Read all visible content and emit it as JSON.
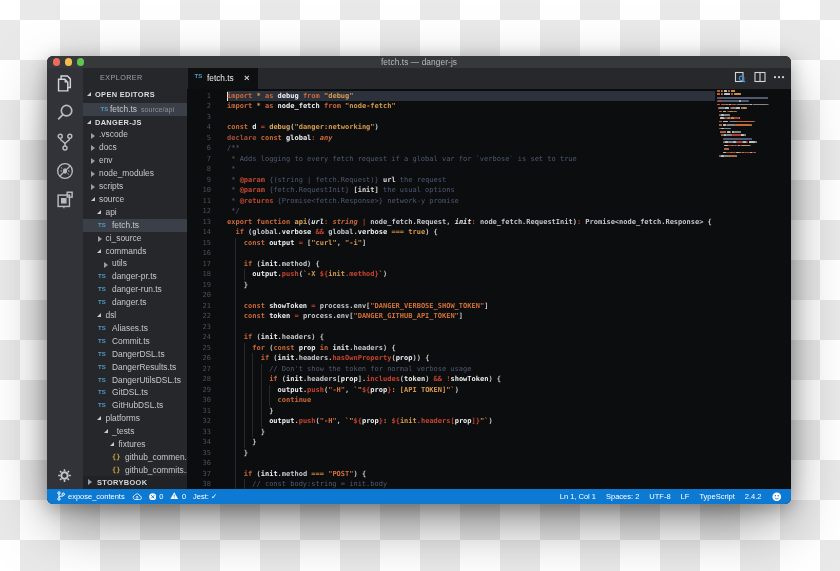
{
  "window": {
    "title": "fetch.ts — danger-js"
  },
  "traffic_lights": [
    {
      "name": "close"
    },
    {
      "name": "minimize"
    },
    {
      "name": "zoom"
    }
  ],
  "activity_bar": {
    "items": [
      {
        "icon": "files-icon",
        "label": "Explorer",
        "active": true
      },
      {
        "icon": "search-icon",
        "label": "Search",
        "active": false
      },
      {
        "icon": "source-control-icon",
        "label": "Source Control",
        "active": false
      },
      {
        "icon": "debug-icon",
        "label": "Debug",
        "active": false
      },
      {
        "icon": "extensions-icon",
        "label": "Extensions",
        "active": false
      }
    ],
    "settings_label": "Settings"
  },
  "sidebar": {
    "title": "EXPLORER",
    "open_editors": {
      "header": "OPEN EDITORS",
      "items": [
        {
          "icon": "TS",
          "label": "fetch.ts",
          "detail": "source/api",
          "selected": true
        }
      ]
    },
    "project": {
      "header": "DANGER-JS",
      "items": [
        {
          "label": ".vscode",
          "depth": 1,
          "kind": "folder-closed"
        },
        {
          "label": "docs",
          "depth": 1,
          "kind": "folder-closed"
        },
        {
          "label": "env",
          "depth": 1,
          "kind": "folder-closed"
        },
        {
          "label": "node_modules",
          "depth": 1,
          "kind": "folder-closed"
        },
        {
          "label": "scripts",
          "depth": 1,
          "kind": "folder-closed"
        },
        {
          "label": "source",
          "depth": 1,
          "kind": "folder-open"
        },
        {
          "label": "api",
          "depth": 2,
          "kind": "folder-open"
        },
        {
          "label": "fetch.ts",
          "depth": 3,
          "kind": "ts",
          "selected": true
        },
        {
          "label": "ci_source",
          "depth": 2,
          "kind": "folder-closed"
        },
        {
          "label": "commands",
          "depth": 2,
          "kind": "folder-open"
        },
        {
          "label": "utils",
          "depth": 3,
          "kind": "folder-closed"
        },
        {
          "label": "danger-pr.ts",
          "depth": 3,
          "kind": "ts"
        },
        {
          "label": "danger-run.ts",
          "depth": 3,
          "kind": "ts"
        },
        {
          "label": "danger.ts",
          "depth": 3,
          "kind": "ts"
        },
        {
          "label": "dsl",
          "depth": 2,
          "kind": "folder-open"
        },
        {
          "label": "Aliases.ts",
          "depth": 3,
          "kind": "ts"
        },
        {
          "label": "Commit.ts",
          "depth": 3,
          "kind": "ts"
        },
        {
          "label": "DangerDSL.ts",
          "depth": 3,
          "kind": "ts"
        },
        {
          "label": "DangerResults.ts",
          "depth": 3,
          "kind": "ts"
        },
        {
          "label": "DangerUtilsDSL.ts",
          "depth": 3,
          "kind": "ts"
        },
        {
          "label": "GitDSL.ts",
          "depth": 3,
          "kind": "ts"
        },
        {
          "label": "GitHubDSL.ts",
          "depth": 3,
          "kind": "ts"
        },
        {
          "label": "platforms",
          "depth": 2,
          "kind": "folder-open"
        },
        {
          "label": "_tests",
          "depth": 3,
          "kind": "folder-open"
        },
        {
          "label": "fixtures",
          "depth": 4,
          "kind": "folder-open"
        },
        {
          "label": "github_commen..",
          "depth": 5,
          "kind": "json"
        },
        {
          "label": "github_commits..",
          "depth": 5,
          "kind": "json"
        }
      ]
    },
    "bottom_section": {
      "header": "STORYBOOK"
    }
  },
  "editor": {
    "tab": {
      "icon": "TS",
      "label": "fetch.ts",
      "close": "×"
    },
    "actions": [
      {
        "icon": "open-preview-icon",
        "label": "Open Preview"
      },
      {
        "icon": "split-editor-icon",
        "label": "Split Editor"
      },
      {
        "icon": "more-actions-icon",
        "label": "More Actions",
        "glyph": "•••"
      }
    ],
    "cursor": {
      "line": 1,
      "col": 1
    }
  },
  "status_bar": {
    "left": [
      {
        "icon": "git-branch-icon",
        "label": "expose_contents"
      },
      {
        "icon": "cloud-upload-icon",
        "label": ""
      },
      {
        "icon": "error-icon",
        "label": "0"
      },
      {
        "icon": "warning-icon",
        "label": "0"
      },
      {
        "icon": "",
        "label": "Jest: ✓"
      }
    ],
    "right": [
      {
        "label": "Ln 1, Col 1"
      },
      {
        "label": "Spaces: 2"
      },
      {
        "label": "UTF-8"
      },
      {
        "label": "LF"
      },
      {
        "label": "TypeScript"
      },
      {
        "label": "2.4.2"
      },
      {
        "icon": "smiley-icon",
        "label": ""
      }
    ]
  },
  "code_lines": [
    [
      1,
      0,
      0,
      [
        [
          "kw",
          "import"
        ],
        [
          "pl",
          " "
        ],
        [
          "gold",
          "*"
        ],
        [
          "pl",
          " "
        ],
        [
          "kw",
          "as"
        ],
        [
          "pl",
          " "
        ],
        [
          "b",
          "debug"
        ],
        [
          "pl",
          " "
        ],
        [
          "kw",
          "from"
        ],
        [
          "pl",
          " "
        ],
        [
          "str",
          "\"debug\""
        ]
      ]
    ],
    [
      2,
      0,
      0,
      [
        [
          "kw",
          "import"
        ],
        [
          "pl",
          " "
        ],
        [
          "gold",
          "*"
        ],
        [
          "pl",
          " "
        ],
        [
          "kw",
          "as"
        ],
        [
          "pl",
          " "
        ],
        [
          "b",
          "node_fetch"
        ],
        [
          "pl",
          " "
        ],
        [
          "kw",
          "from"
        ],
        [
          "pl",
          " "
        ],
        [
          "str",
          "\"node-fetch\""
        ]
      ]
    ],
    [
      3,
      0,
      0,
      []
    ],
    [
      4,
      0,
      0,
      [
        [
          "kw",
          "const"
        ],
        [
          "pl",
          " "
        ],
        [
          "b",
          "d"
        ],
        [
          "pl",
          " "
        ],
        [
          "red",
          "="
        ],
        [
          "pl",
          " "
        ],
        [
          "fn",
          "debug"
        ],
        [
          "pl",
          "("
        ],
        [
          "str",
          "\"danger:networking\""
        ],
        [
          "pl",
          ")"
        ]
      ]
    ],
    [
      5,
      0,
      0,
      [
        [
          "kwd",
          "declare"
        ],
        [
          "pl",
          " "
        ],
        [
          "kw",
          "const"
        ],
        [
          "pl",
          " "
        ],
        [
          "b",
          "global"
        ],
        [
          "red",
          ":"
        ],
        [
          "pl",
          " "
        ],
        [
          "type",
          "any"
        ]
      ]
    ],
    [
      6,
      0,
      0,
      [
        [
          "cm",
          "/**"
        ]
      ]
    ],
    [
      7,
      0,
      0,
      [
        [
          "cm",
          " * Adds logging to every fetch request if a global var for `verbose` is set to true"
        ]
      ]
    ],
    [
      8,
      0,
      0,
      [
        [
          "cm",
          " *"
        ]
      ]
    ],
    [
      9,
      0,
      0,
      [
        [
          "cm",
          " * "
        ],
        [
          "tag",
          "@param"
        ],
        [
          "cm",
          " {(string | fetch.Request)} "
        ],
        [
          "docb",
          "url"
        ],
        [
          "cm",
          " the request"
        ]
      ]
    ],
    [
      10,
      0,
      0,
      [
        [
          "cm",
          " * "
        ],
        [
          "tag",
          "@param"
        ],
        [
          "cm",
          " {fetch.RequestInit} "
        ],
        [
          "docb",
          "[init]"
        ],
        [
          "cm",
          " the usual options"
        ]
      ]
    ],
    [
      11,
      0,
      0,
      [
        [
          "cm",
          " * "
        ],
        [
          "tag",
          "@returns"
        ],
        [
          "cm",
          " {Promise<fetch.Response>} network-y promise"
        ]
      ]
    ],
    [
      12,
      0,
      0,
      [
        [
          "cm",
          " */"
        ]
      ]
    ],
    [
      13,
      0,
      0,
      [
        [
          "kw",
          "export"
        ],
        [
          "pl",
          " "
        ],
        [
          "kw",
          "function"
        ],
        [
          "pl",
          " "
        ],
        [
          "fn",
          "api"
        ],
        [
          "pl",
          "("
        ],
        [
          "param",
          "url"
        ],
        [
          "red",
          ":"
        ],
        [
          "pl",
          " "
        ],
        [
          "type",
          "string"
        ],
        [
          "pl",
          " "
        ],
        [
          "red",
          "|"
        ],
        [
          "pl",
          " node_fetch.Request, "
        ],
        [
          "param",
          "init"
        ],
        [
          "red",
          ":"
        ],
        [
          "pl",
          " node_fetch.RequestInit)"
        ],
        [
          "red",
          ":"
        ],
        [
          "pl",
          " Promise<node_fetch.Response> {"
        ]
      ]
    ],
    [
      14,
      2,
      0,
      [
        [
          "kw",
          "if"
        ],
        [
          "pl",
          " (global."
        ],
        [
          "b",
          "verbose"
        ],
        [
          "pl",
          " "
        ],
        [
          "red",
          "&&"
        ],
        [
          "pl",
          " global."
        ],
        [
          "b",
          "verbose"
        ],
        [
          "pl",
          " "
        ],
        [
          "eq",
          "==="
        ],
        [
          "pl",
          " "
        ],
        [
          "gold",
          "true"
        ],
        [
          "pl",
          ") {"
        ]
      ]
    ],
    [
      15,
      4,
      1,
      [
        [
          "kw",
          "const"
        ],
        [
          "pl",
          " "
        ],
        [
          "b",
          "output"
        ],
        [
          "pl",
          " "
        ],
        [
          "red",
          "="
        ],
        [
          "pl",
          " ["
        ],
        [
          "str",
          "\"curl\""
        ],
        [
          "pl",
          ", "
        ],
        [
          "str",
          "\"-i\""
        ],
        [
          "pl",
          "]"
        ]
      ]
    ],
    [
      16,
      0,
      1,
      []
    ],
    [
      17,
      4,
      1,
      [
        [
          "kw",
          "if"
        ],
        [
          "pl",
          " ("
        ],
        [
          "b",
          "init"
        ],
        [
          "pl",
          ".method) {"
        ]
      ]
    ],
    [
      18,
      6,
      2,
      [
        [
          "b",
          "output"
        ],
        [
          "pl",
          "."
        ],
        [
          "red",
          "push"
        ],
        [
          "pl",
          "("
        ],
        [
          "str",
          "`-X "
        ],
        [
          "red",
          "${"
        ],
        [
          "gold",
          "init"
        ],
        [
          "red",
          ".method}"
        ],
        [
          "str",
          "`"
        ],
        [
          "pl",
          ")"
        ]
      ]
    ],
    [
      19,
      4,
      1,
      [
        [
          "pl",
          "}"
        ]
      ]
    ],
    [
      20,
      0,
      1,
      []
    ],
    [
      21,
      4,
      1,
      [
        [
          "kw",
          "const"
        ],
        [
          "pl",
          " "
        ],
        [
          "b",
          "showToken"
        ],
        [
          "pl",
          " "
        ],
        [
          "red",
          "="
        ],
        [
          "pl",
          " process.env["
        ],
        [
          "str2",
          "\"DANGER_VERBOSE_SHOW_TOKEN\""
        ],
        [
          "pl",
          "]"
        ]
      ]
    ],
    [
      22,
      4,
      1,
      [
        [
          "kw",
          "const"
        ],
        [
          "pl",
          " "
        ],
        [
          "b",
          "token"
        ],
        [
          "pl",
          " "
        ],
        [
          "red",
          "="
        ],
        [
          "pl",
          " process.env["
        ],
        [
          "str2",
          "\"DANGER_GITHUB_API_TOKEN\""
        ],
        [
          "pl",
          "]"
        ]
      ]
    ],
    [
      23,
      0,
      1,
      []
    ],
    [
      24,
      4,
      1,
      [
        [
          "kw",
          "if"
        ],
        [
          "pl",
          " ("
        ],
        [
          "b",
          "init"
        ],
        [
          "pl",
          ".headers) {"
        ]
      ]
    ],
    [
      25,
      6,
      2,
      [
        [
          "kw",
          "for"
        ],
        [
          "pl",
          " ("
        ],
        [
          "kw",
          "const"
        ],
        [
          "pl",
          " "
        ],
        [
          "b",
          "prop"
        ],
        [
          "pl",
          " "
        ],
        [
          "kw",
          "in"
        ],
        [
          "pl",
          " "
        ],
        [
          "b",
          "init"
        ],
        [
          "pl",
          ".headers) {"
        ]
      ]
    ],
    [
      26,
      8,
      3,
      [
        [
          "kw",
          "if"
        ],
        [
          "pl",
          " ("
        ],
        [
          "b",
          "init"
        ],
        [
          "pl",
          ".headers."
        ],
        [
          "red",
          "hasOwnProperty"
        ],
        [
          "pl",
          "("
        ],
        [
          "b",
          "prop"
        ],
        [
          "pl",
          ")) {"
        ]
      ]
    ],
    [
      27,
      10,
      4,
      [
        [
          "cm",
          "// Don't show the token for normal verbose usage"
        ]
      ]
    ],
    [
      28,
      10,
      4,
      [
        [
          "kw",
          "if"
        ],
        [
          "pl",
          " ("
        ],
        [
          "b",
          "init"
        ],
        [
          "pl",
          ".headers["
        ],
        [
          "b",
          "prop"
        ],
        [
          "pl",
          "]."
        ],
        [
          "red",
          "includes"
        ],
        [
          "pl",
          "("
        ],
        [
          "b",
          "token"
        ],
        [
          "pl",
          ") "
        ],
        [
          "red",
          "&&"
        ],
        [
          "pl",
          " "
        ],
        [
          "red",
          "!"
        ],
        [
          "b",
          "showToken"
        ],
        [
          "pl",
          ") {"
        ]
      ]
    ],
    [
      29,
      12,
      5,
      [
        [
          "b",
          "output"
        ],
        [
          "pl",
          "."
        ],
        [
          "red",
          "push"
        ],
        [
          "pl",
          "("
        ],
        [
          "str2",
          "\"-H\""
        ],
        [
          "pl",
          ", "
        ],
        [
          "str",
          "`\""
        ],
        [
          "red",
          "${"
        ],
        [
          "b",
          "prop"
        ],
        [
          "red",
          "}"
        ],
        [
          "str",
          ": [API TOKEN]\"`"
        ],
        [
          "pl",
          ")"
        ]
      ]
    ],
    [
      30,
      12,
      5,
      [
        [
          "kw",
          "continue"
        ]
      ]
    ],
    [
      31,
      10,
      4,
      [
        [
          "pl",
          "}"
        ]
      ]
    ],
    [
      32,
      10,
      4,
      [
        [
          "b",
          "output"
        ],
        [
          "pl",
          "."
        ],
        [
          "red",
          "push"
        ],
        [
          "pl",
          "("
        ],
        [
          "str2",
          "\"-H\""
        ],
        [
          "pl",
          ", "
        ],
        [
          "str",
          "`\""
        ],
        [
          "red",
          "${"
        ],
        [
          "b",
          "prop"
        ],
        [
          "red",
          "}"
        ],
        [
          "str",
          ": "
        ],
        [
          "red",
          "${"
        ],
        [
          "gold",
          "init"
        ],
        [
          "red",
          ".headers["
        ],
        [
          "b",
          "prop"
        ],
        [
          "red",
          "]}"
        ],
        [
          "str",
          "\"`"
        ],
        [
          "pl",
          ")"
        ]
      ]
    ],
    [
      33,
      8,
      3,
      [
        [
          "pl",
          "}"
        ]
      ]
    ],
    [
      34,
      6,
      2,
      [
        [
          "pl",
          "}"
        ]
      ]
    ],
    [
      35,
      4,
      1,
      [
        [
          "pl",
          "}"
        ]
      ]
    ],
    [
      36,
      0,
      1,
      []
    ],
    [
      37,
      4,
      1,
      [
        [
          "kw",
          "if"
        ],
        [
          "pl",
          " ("
        ],
        [
          "b",
          "init"
        ],
        [
          "pl",
          ".method "
        ],
        [
          "eq",
          "==="
        ],
        [
          "pl",
          " "
        ],
        [
          "str2",
          "\"POST\""
        ],
        [
          "pl",
          ") {"
        ]
      ]
    ],
    [
      38,
      6,
      2,
      [
        [
          "cm",
          "// const body:string = init.body"
        ]
      ]
    ]
  ]
}
